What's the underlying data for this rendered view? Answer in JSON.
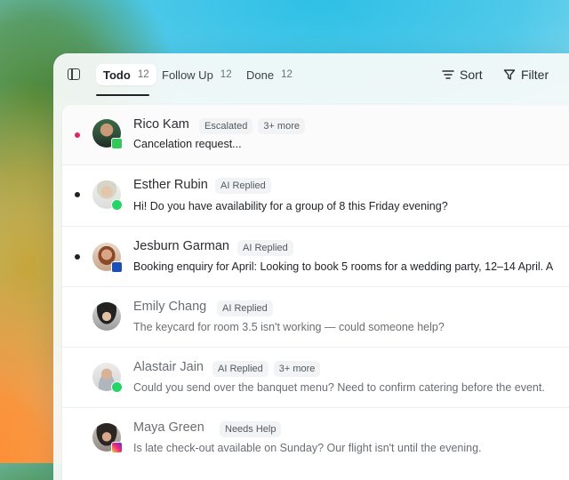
{
  "tabs": [
    {
      "label": "Todo",
      "count": "12"
    },
    {
      "label": "Follow Up",
      "count": "12"
    },
    {
      "label": "Done",
      "count": "12"
    }
  ],
  "toolbar": {
    "sort_label": "Sort",
    "filter_label": "Filter"
  },
  "conversations": [
    {
      "name": "Rico Kam",
      "tags": [
        "Escalated",
        "3+ more"
      ],
      "message": "Cancelation request...",
      "unread_dot_color": "#e0245e",
      "channel_icon": "imessage-icon"
    },
    {
      "name": "Esther Rubin",
      "tags": [
        "AI Replied"
      ],
      "message": "Hi! Do you have availability for a group of 8 this Friday evening?",
      "unread_dot_color": "#1f2226",
      "channel_icon": "whatsapp-icon"
    },
    {
      "name": "Jesburn Garman",
      "tags": [
        "AI Replied"
      ],
      "message": "Booking enquiry for April: Looking to book 5 rooms for a wedding party, 12–14 April. A",
      "unread_dot_color": "#1f2226",
      "channel_icon": "booking-icon"
    },
    {
      "name": "Emily Chang",
      "tags": [
        "AI Replied"
      ],
      "message": "The keycard for room 3.5 isn't working — could someone help?",
      "unread_dot_color": "",
      "channel_icon": "none"
    },
    {
      "name": "Alastair Jain",
      "tags": [
        "AI Replied",
        "3+ more"
      ],
      "message": "Could you send over the banquet menu? Need to confirm catering before the event.",
      "unread_dot_color": "",
      "channel_icon": "whatsapp-icon"
    },
    {
      "name": "Maya Green",
      "tags": [
        "Needs Help"
      ],
      "message": "Is late check-out available on Sunday? Our flight isn't until the evening.",
      "unread_dot_color": "",
      "channel_icon": "instagram-icon"
    }
  ]
}
